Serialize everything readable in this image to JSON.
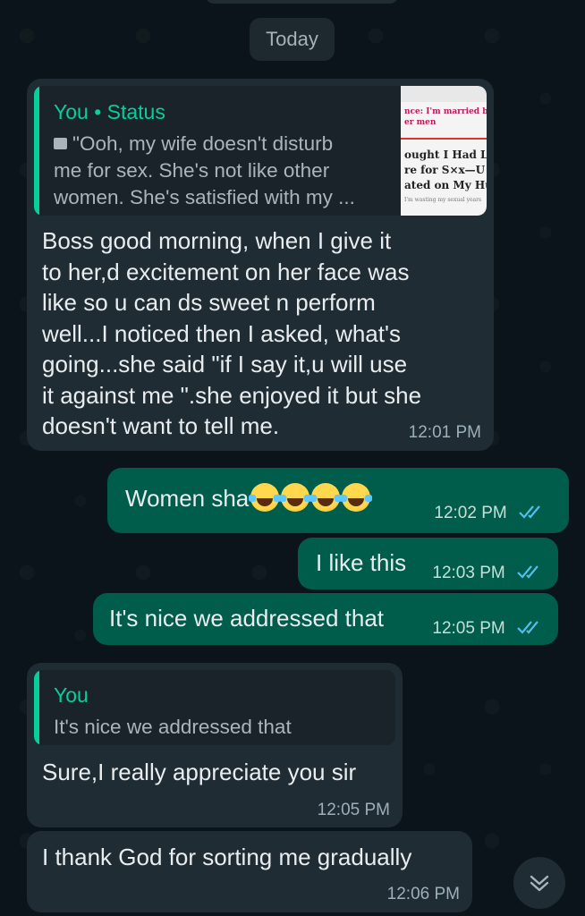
{
  "date_chip": "Today",
  "messages": [
    {
      "direction": "incoming",
      "quote": {
        "author": "You • Status",
        "text_lines": [
          "\"Ooh, my wife doesn't disturb",
          "me for sex. She's not like other",
          "women. She's satisfied with my ..."
        ],
        "thumbnail_lines": [
          "nce: I'm married but",
          "er men",
          "ought I Had L",
          "re for S×x—U",
          "ated on My Hu",
          "I'm wasting my sexual years"
        ]
      },
      "text_lines": [
        "Boss good morning, when I give it",
        "to her,d excitement on her face was",
        "like so u can ds sweet n perform",
        "well...I noticed then I asked, what's",
        "going...she said \"if I say it,u will use",
        "it against me \".she enjoyed it but she",
        "doesn't want to tell me."
      ],
      "time": "12:01 PM"
    },
    {
      "direction": "outgoing",
      "text": "Women sha",
      "emoji_count": 4,
      "time": "12:02 PM",
      "status": "read"
    },
    {
      "direction": "outgoing",
      "text": "I like this",
      "time": "12:03 PM",
      "status": "read"
    },
    {
      "direction": "outgoing",
      "text": "It's nice we addressed that",
      "time": "12:05 PM",
      "status": "read"
    },
    {
      "direction": "incoming",
      "quote": {
        "author": "You",
        "text": "It's nice we addressed that"
      },
      "text": "Sure,I really appreciate you sir",
      "time": "12:05 PM"
    },
    {
      "direction": "incoming",
      "text": "I thank God for sorting me gradually",
      "time": "12:06 PM"
    }
  ],
  "colors": {
    "background": "#0b141a",
    "incoming_bubble": "#1f2c34",
    "outgoing_bubble": "#005c4b",
    "accent": "#06cf9c",
    "read_ticks": "#53bdeb"
  },
  "icons": {
    "thumbnail_indicator": "photo-icon",
    "read_status": "double-check-icon",
    "scroll": "chevron-down-double-icon"
  }
}
